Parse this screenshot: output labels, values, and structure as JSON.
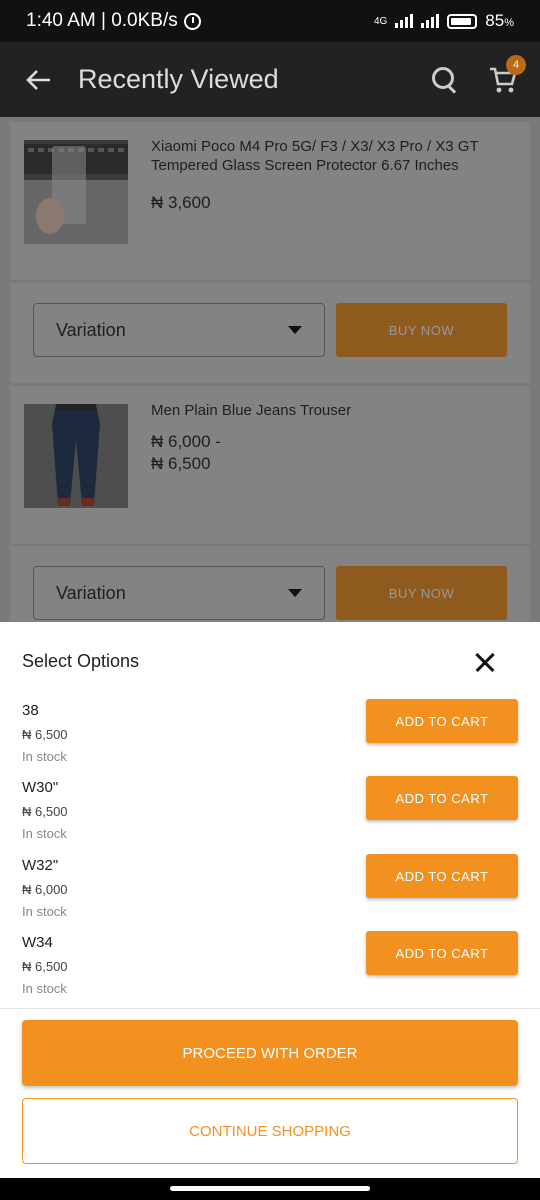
{
  "status_bar": {
    "time_speed": "1:40 AM | 0.0KB/s",
    "network": "4G",
    "battery": "85"
  },
  "app_bar": {
    "back_icon": "arrow-left-icon",
    "title": "Recently Viewed",
    "cart_count": "4"
  },
  "products": [
    {
      "name": "Xiaomi Poco M4 Pro 5G/ F3 / X3/ X3 Pro / X3 GT Tempered Glass Screen Protector 6.67 Inches",
      "price_lines": [
        "₦ 3,600"
      ],
      "variation_label": "Variation",
      "buy_label": "BUY NOW"
    },
    {
      "name": "Men Plain Blue Jeans Trouser",
      "price_lines": [
        "₦ 6,000 -",
        "₦ 6,500"
      ],
      "variation_label": "Variation",
      "buy_label": "BUY NOW"
    }
  ],
  "sheet": {
    "title": "Select Options",
    "options": [
      {
        "name": "38",
        "price": "₦ 6,500",
        "stock": "In stock",
        "button": "ADD TO CART"
      },
      {
        "name": "W30\"",
        "price": "₦ 6,500",
        "stock": "In stock",
        "button": "ADD TO CART"
      },
      {
        "name": "W32\"",
        "price": "₦ 6,000",
        "stock": "In stock",
        "button": "ADD TO CART"
      },
      {
        "name": "W34",
        "price": "₦ 6,500",
        "stock": "In stock",
        "button": "ADD TO CART"
      }
    ],
    "proceed_label": "PROCEED WITH ORDER",
    "continue_label": "CONTINUE SHOPPING"
  },
  "colors": {
    "accent": "#f39120",
    "app_bar": "#222222",
    "overlay": "#7a7a7a"
  }
}
